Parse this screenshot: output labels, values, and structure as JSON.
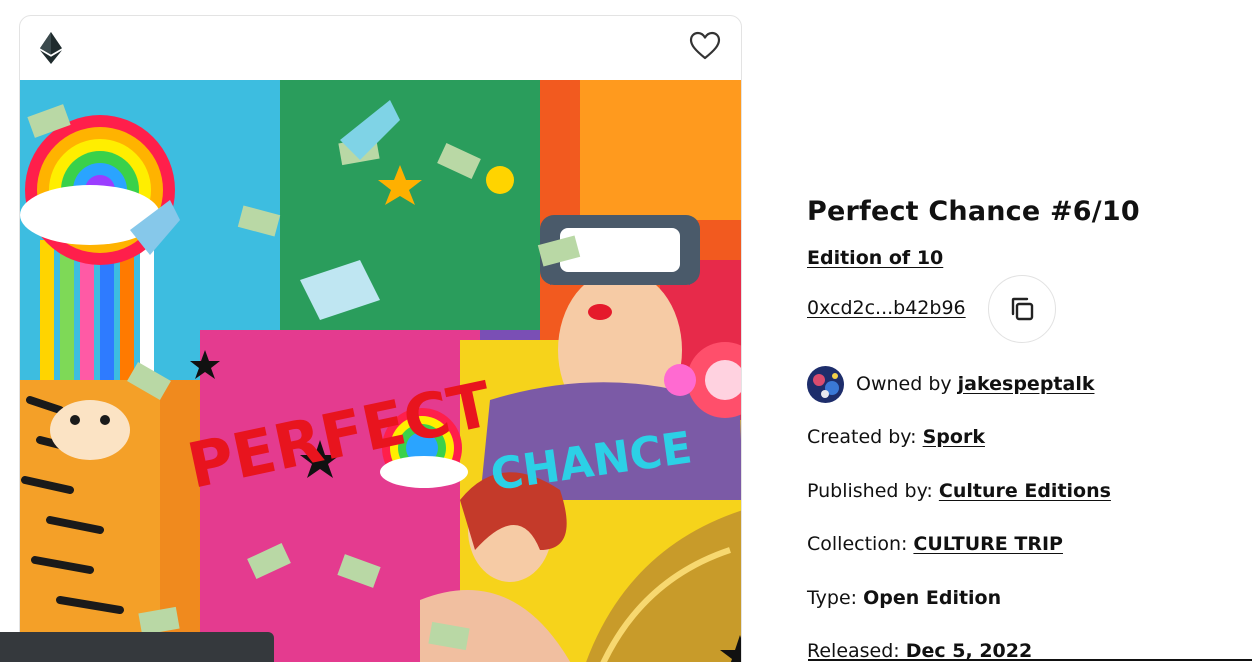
{
  "artwork": {
    "text_perfect": "PERFECT",
    "text_chance": "CHANCE"
  },
  "token": {
    "title": "Perfect Chance #6/10",
    "edition_label": "Edition of 10",
    "contract_address": "0xcd2c...b42b96"
  },
  "owner": {
    "prefix": "Owned by ",
    "name": "jakespeptalk"
  },
  "details": {
    "created_by_label": "Created by: ",
    "created_by_value": "Spork",
    "published_by_label": "Published by: ",
    "published_by_value": "Culture Editions",
    "collection_label": "Collection: ",
    "collection_value": "CULTURE TRIP",
    "type_label": "Type: ",
    "type_value": "Open Edition",
    "released_label": "Released: ",
    "released_value": "Dec 5, 2022"
  },
  "icons": {
    "network": "ethereum-icon",
    "favorite": "heart-outline-icon",
    "copy": "copy-icon"
  },
  "colors": {
    "text": "#111111",
    "border": "#e3e3e3",
    "dark_bar": "#35393d"
  }
}
